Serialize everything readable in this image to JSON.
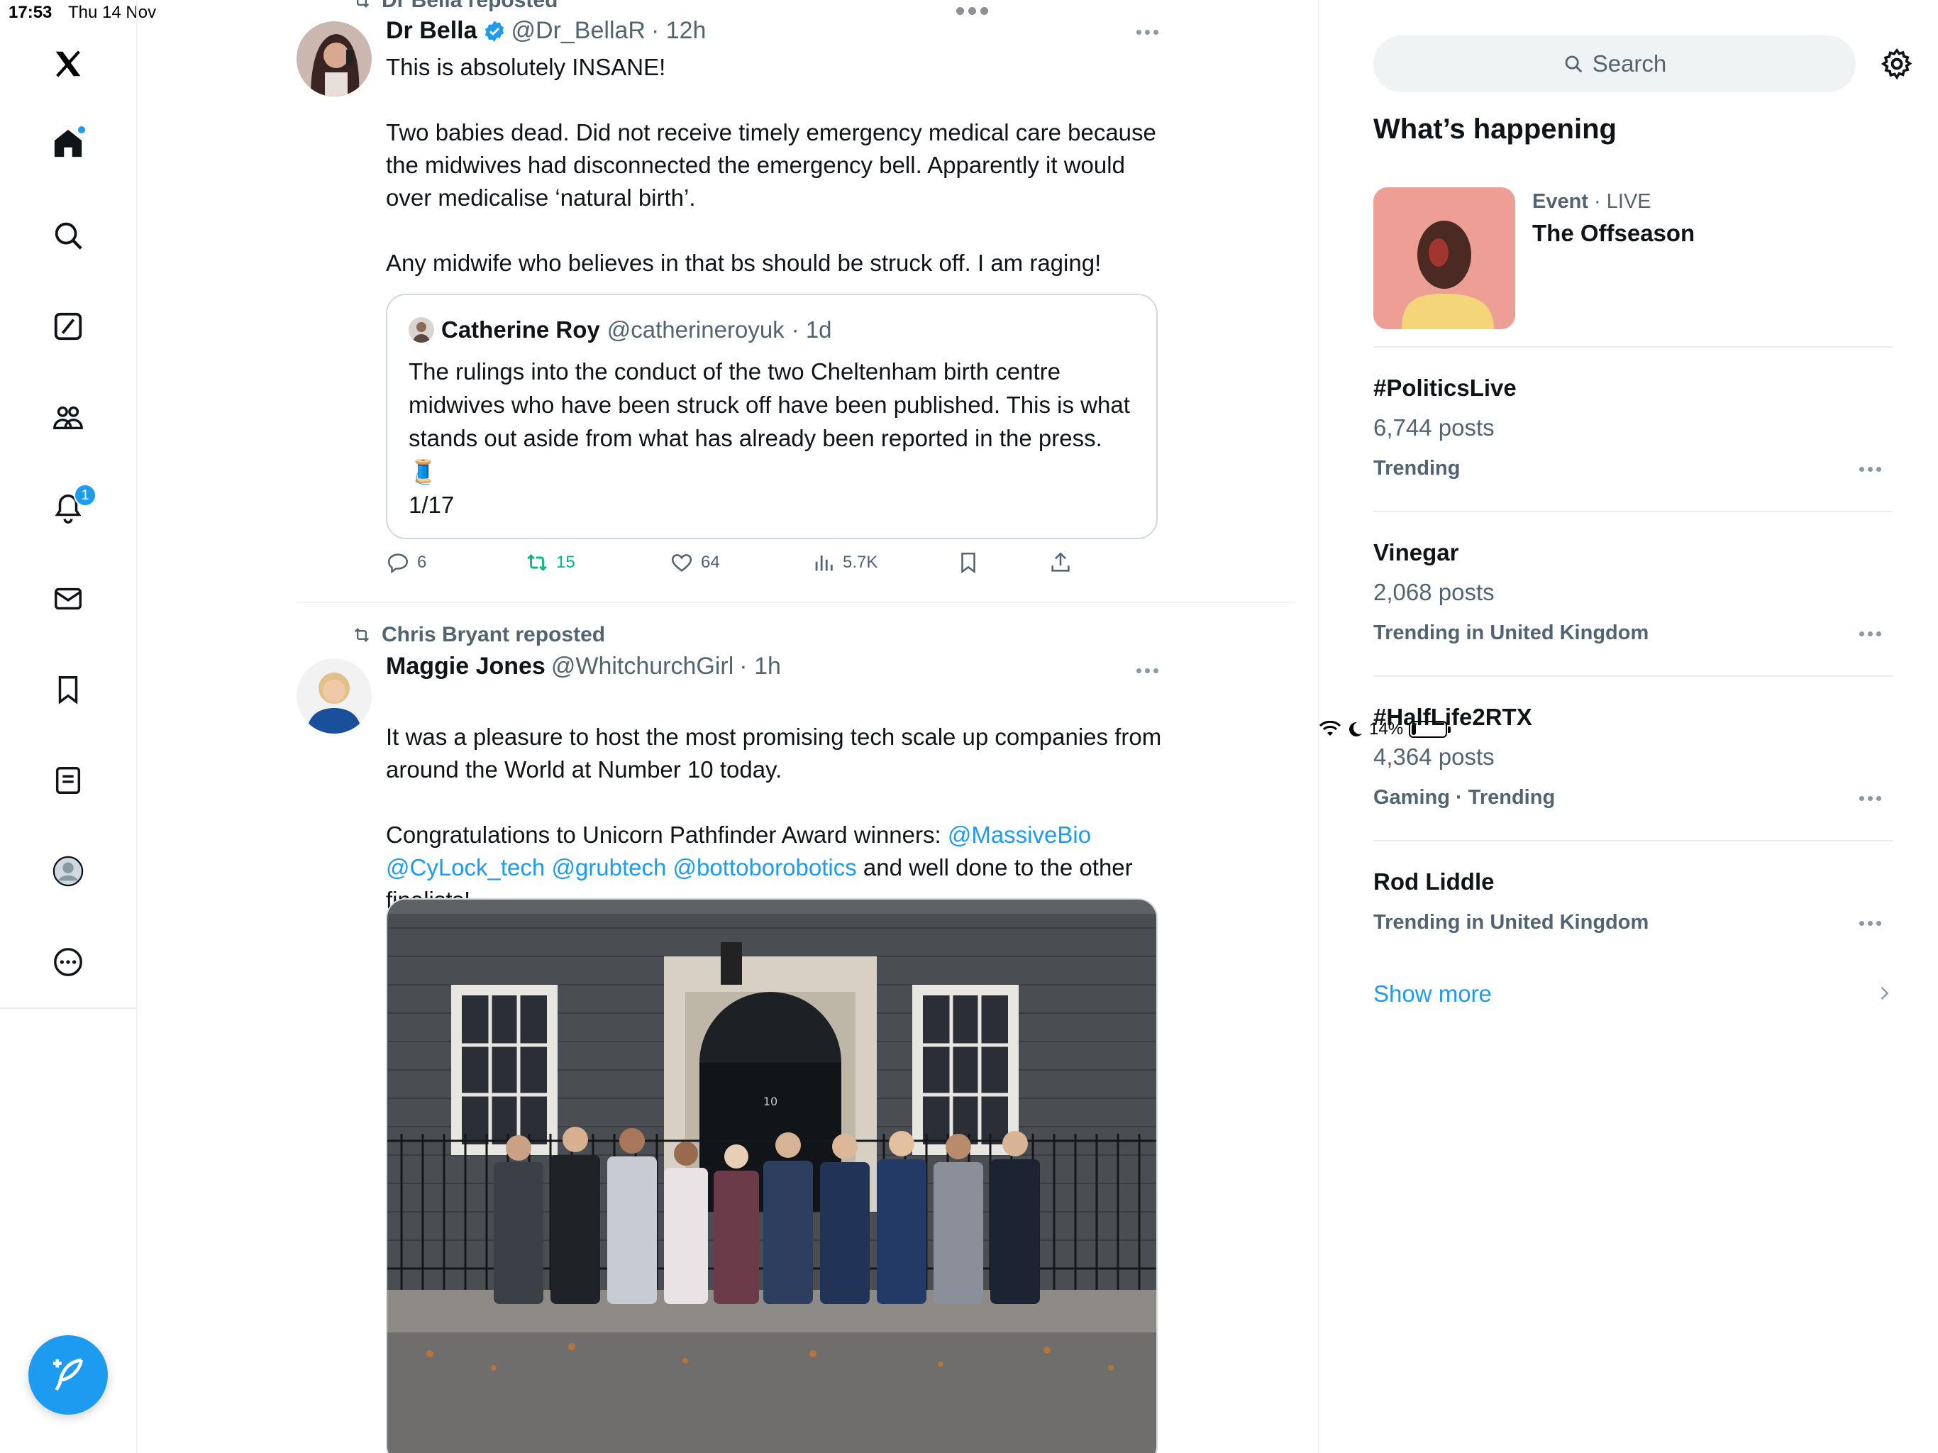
{
  "status_bar": {
    "time": "17:53",
    "date": "Thu 14 Nov",
    "battery": "14%",
    "battery_level": 0.14
  },
  "left_nav": {
    "items": [
      {
        "icon": "x-logo-icon"
      },
      {
        "icon": "home-icon",
        "has_dot": true
      },
      {
        "icon": "search-icon"
      },
      {
        "icon": "grok-icon"
      },
      {
        "icon": "communities-icon"
      },
      {
        "icon": "notifications-icon",
        "badge": "1"
      },
      {
        "icon": "messages-icon"
      },
      {
        "icon": "bookmarks-icon"
      },
      {
        "icon": "lists-icon"
      },
      {
        "icon": "profile-icon"
      },
      {
        "icon": "more-icon"
      }
    ],
    "compose_icon": "compose-icon"
  },
  "feed": {
    "tweets": [
      {
        "repost_label": "Dr Bella reposted",
        "name": "Dr Bella",
        "verified": true,
        "handle": "@Dr_BellaR",
        "time": "· 12h",
        "text": "This is absolutely INSANE!\n\nTwo babies dead. Did not receive timely emergency medical care because the midwives had disconnected the emergency bell. Apparently it would over medicalise ‘natural birth’.\n\nAny midwife who believes in that bs should be struck off.  I am raging!",
        "quote": {
          "name": "Catherine Roy",
          "handle": "@catherineroyuk",
          "time": "· 1d",
          "text": "The rulings into the conduct of the two Cheltenham birth centre midwives who have been struck off have been published. This is what stands out aside from what has already been reported in the press. 🧵\n1/17"
        },
        "actions": {
          "replies": "6",
          "reposts": "15",
          "likes": "64",
          "views": "5.7K"
        }
      },
      {
        "repost_label": "Chris Bryant reposted",
        "name": "Maggie Jones",
        "handle": "@WhitchurchGirl",
        "time": "· 1h",
        "text_line1": "It was a pleasure to host the most promising tech scale up companies from around the World at Number 10 today.",
        "text_congrats": "Congratulations to Unicorn Pathfinder Award winners: ",
        "mentions": [
          "@MassiveBio",
          "@CyLock_tech",
          "@grubtech",
          "@bottoborobotics"
        ],
        "text_end": " and well done to the other finalists!"
      }
    ]
  },
  "sidebar": {
    "search_placeholder": "Search",
    "title": "What’s happening",
    "event": {
      "kind": "Event",
      "status": "· LIVE",
      "title": "The Offseason"
    },
    "trends": [
      {
        "name": "#PoliticsLive",
        "posts": "6,744 posts",
        "context": "Trending"
      },
      {
        "name": "Vinegar",
        "posts": "2,068 posts",
        "context": "Trending in United Kingdom"
      },
      {
        "name": "#HalfLife2RTX",
        "posts": "4,364 posts",
        "context": "Gaming · Trending"
      },
      {
        "name": "Rod Liddle",
        "posts": "",
        "context": "Trending in United Kingdom"
      }
    ],
    "show_more": "Show more"
  },
  "colors": {
    "accent": "#1d9bf0",
    "repost_green": "#00ba7c",
    "muted_text": "#536471",
    "border": "#cfd9de"
  }
}
